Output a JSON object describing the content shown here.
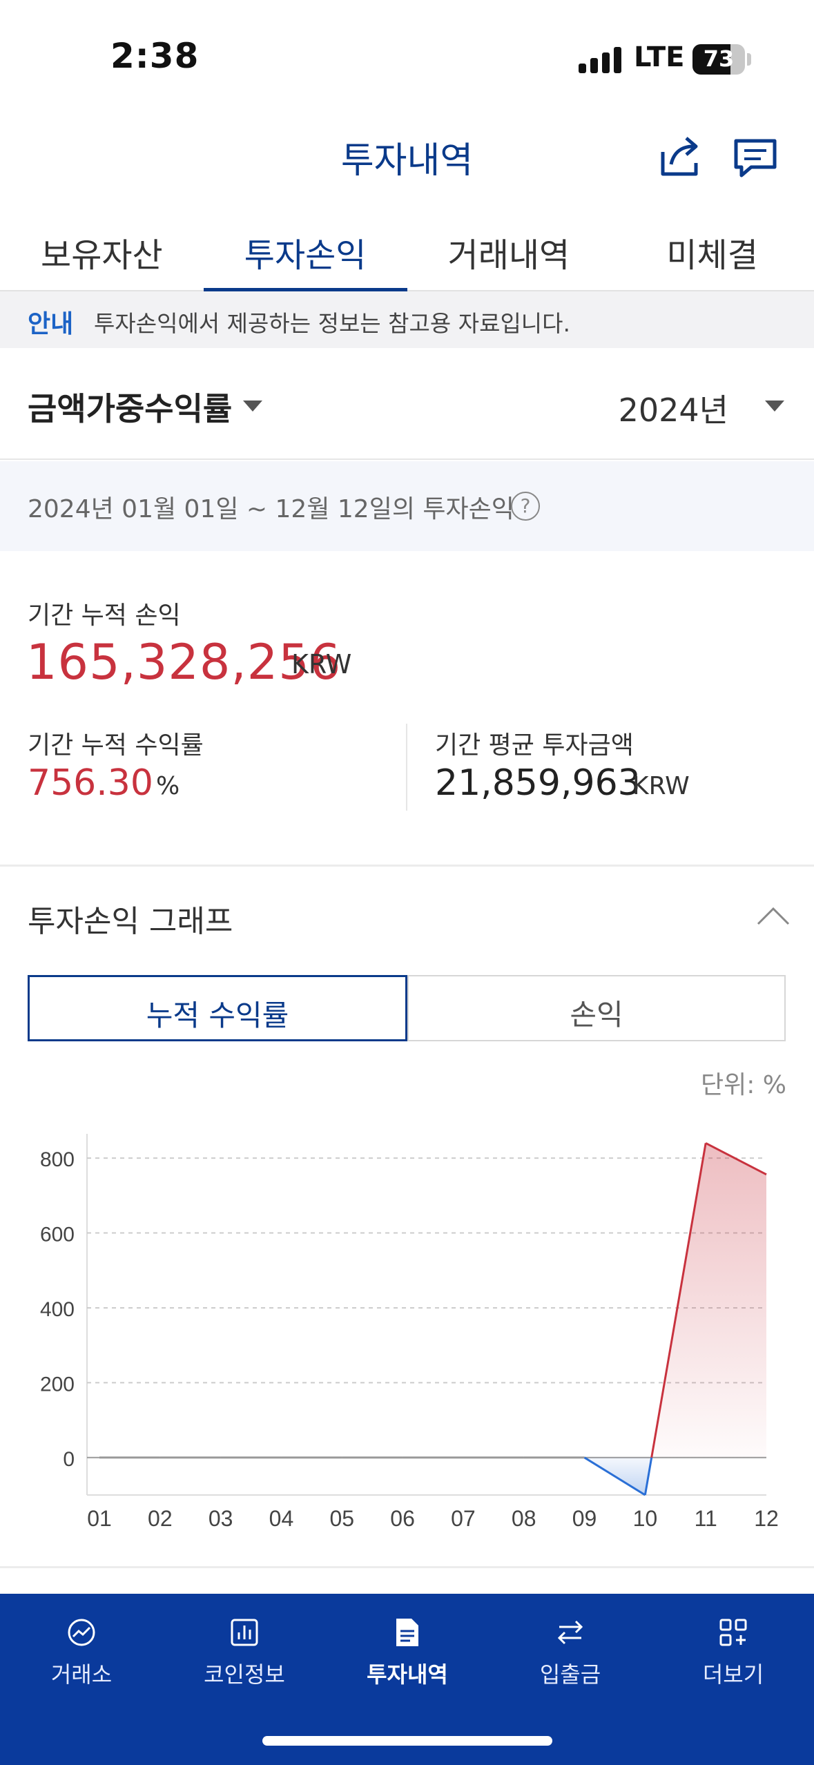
{
  "status_bar": {
    "time": "2:38",
    "network": "LTE",
    "battery": "73"
  },
  "header": {
    "title": "투자내역",
    "share_icon": "share-icon",
    "chat_icon": "chat-icon"
  },
  "tabs": [
    {
      "label": "보유자산",
      "active": false
    },
    {
      "label": "투자손익",
      "active": true
    },
    {
      "label": "거래내역",
      "active": false
    },
    {
      "label": "미체결",
      "active": false
    }
  ],
  "notice": {
    "tag": "안내",
    "text": "투자손익에서 제공하는 정보는 참고용 자료입니다."
  },
  "selector": {
    "metric": "금액가중수익률",
    "year": "2024년"
  },
  "period": {
    "text": "2024년 01월 01일 ~ 12월 12일의 투자손익"
  },
  "summary": {
    "cumulative_pl_label": "기간 누적 손익",
    "cumulative_pl_value": "165,328,256",
    "cumulative_pl_unit": "KRW",
    "cumulative_rate_label": "기간 누적 수익률",
    "cumulative_rate_value": "756.30",
    "cumulative_rate_unit": "%",
    "avg_invest_label": "기간 평균 투자금액",
    "avg_invest_value": "21,859,963",
    "avg_invest_unit": "KRW"
  },
  "graph": {
    "title": "투자손익 그래프",
    "toggle": [
      {
        "label": "누적 수익률",
        "active": true
      },
      {
        "label": "손익",
        "active": false
      }
    ],
    "unit_label": "단위: %"
  },
  "chart_data": {
    "type": "line",
    "categories": [
      "01",
      "02",
      "03",
      "04",
      "05",
      "06",
      "07",
      "08",
      "09",
      "10",
      "11",
      "12"
    ],
    "series": [
      {
        "values": [
          0,
          0,
          0,
          0,
          0,
          0,
          0,
          0,
          0,
          -100,
          840,
          756.3
        ]
      }
    ],
    "yticks": [
      0,
      200,
      400,
      600,
      800
    ],
    "ylim": [
      -100,
      850
    ],
    "grid": true,
    "colors": {
      "positive": "#c8323e",
      "negative": "#2a6fd6",
      "zero_line": "#999999"
    }
  },
  "bottom_nav": [
    {
      "label": "거래소",
      "icon": "chart-trend-icon",
      "active": false
    },
    {
      "label": "코인정보",
      "icon": "bar-chart-icon",
      "active": false
    },
    {
      "label": "투자내역",
      "icon": "document-icon",
      "active": true
    },
    {
      "label": "입출금",
      "icon": "transfer-arrows-icon",
      "active": false
    },
    {
      "label": "더보기",
      "icon": "grid-plus-icon",
      "active": false
    }
  ]
}
